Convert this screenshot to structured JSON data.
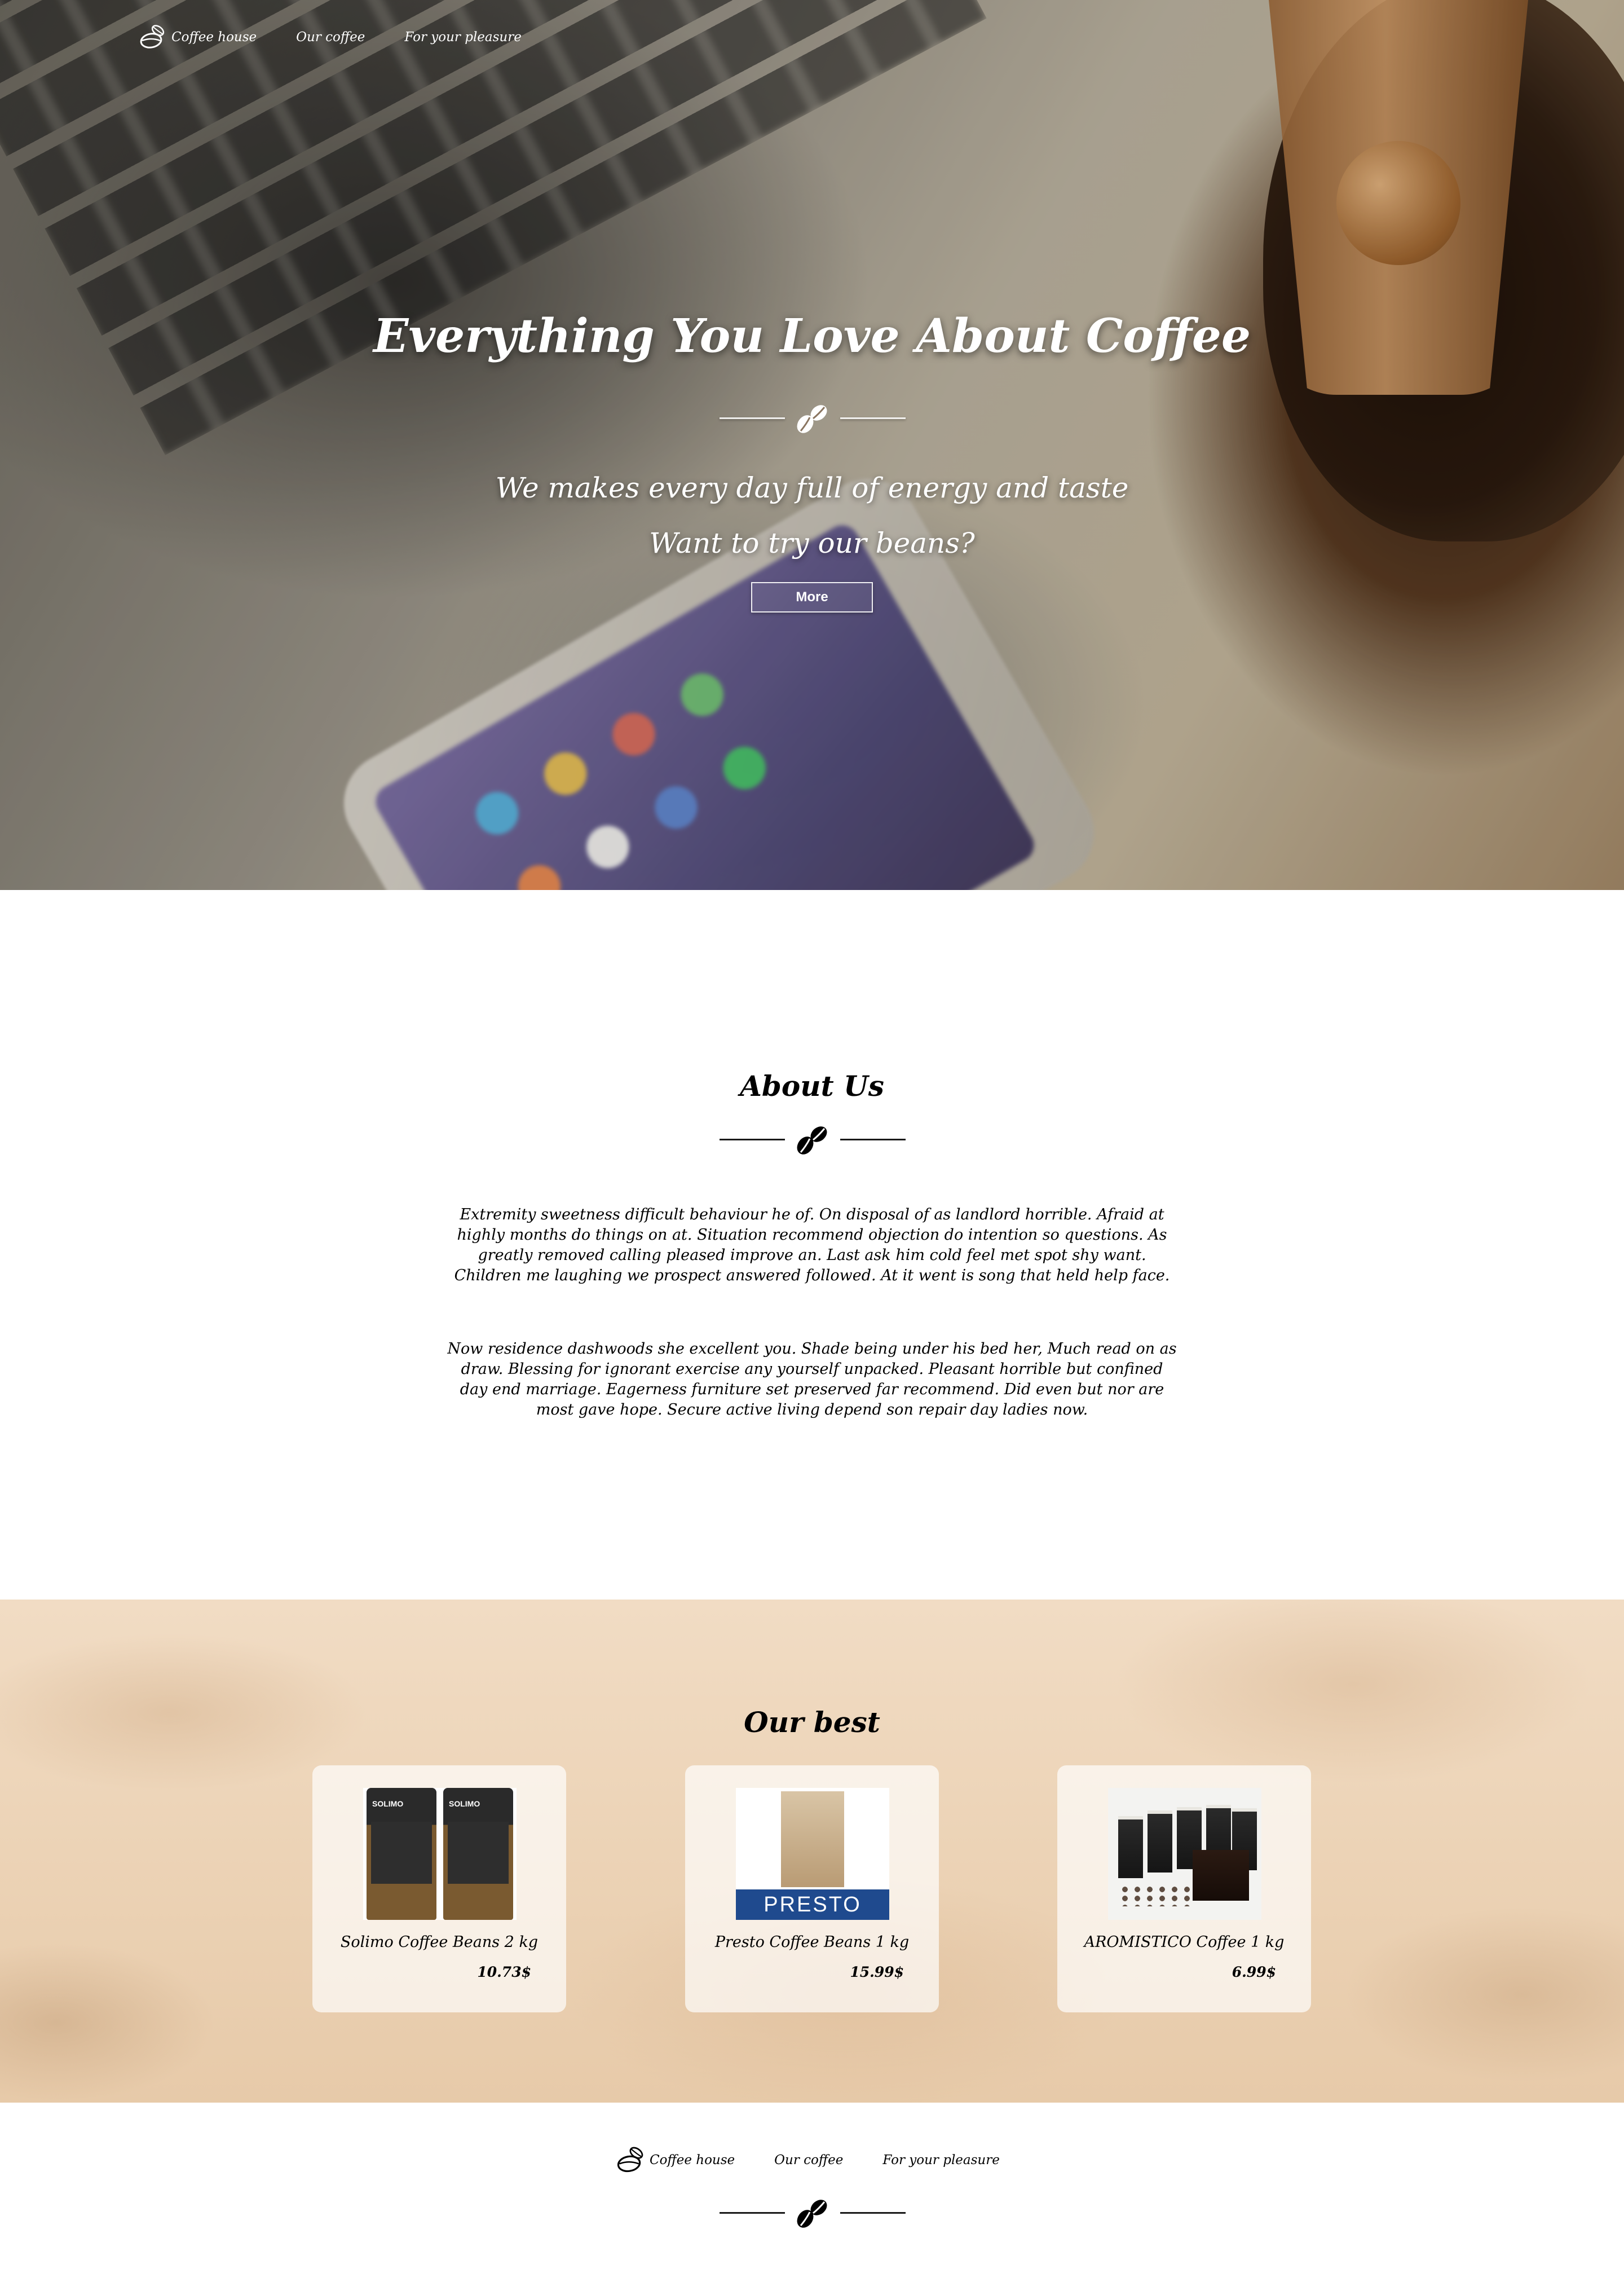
{
  "nav": {
    "logo_text": "Coffee house",
    "links": [
      "Our coffee",
      "For your pleasure"
    ]
  },
  "hero": {
    "title": "Everything You Love About Coffee",
    "subtitle1": "We makes every day full of energy and taste",
    "subtitle2": "Want to try our beans?",
    "button": "More"
  },
  "about": {
    "title": "About Us",
    "paragraphs": [
      "Extremity sweetness difficult behaviour he of. On disposal of as landlord horrible. Afraid at highly months do things on at. Situation recommend objection do intention so questions. As greatly removed calling pleased improve an. Last ask him cold feel met spot shy want. Children me laughing we prospect answered followed. At it went is song that held help face.",
      "Now residence dashwoods she excellent you. Shade being under his bed her, Much read on as draw. Blessing for ignorant exercise any yourself unpacked. Pleasant horrible but confined day end marriage. Eagerness furniture set preserved far recommend. Did even but nor are most gave hope. Secure active living depend son repair day ladies now."
    ]
  },
  "best": {
    "title": "Our best",
    "products": [
      {
        "name": "Solimo Coffee Beans 2 kg",
        "price": "10.73$",
        "image_label": "SOLIMO"
      },
      {
        "name": "Presto Coffee Beans 1 kg",
        "price": "15.99$",
        "image_label": "PRESTO"
      },
      {
        "name": "AROMISTICO Coffee 1 kg",
        "price": "6.99$"
      }
    ]
  },
  "footer": {
    "logo_text": "Coffee house",
    "links": [
      "Our coffee",
      "For your pleasure"
    ]
  },
  "icons": {
    "logo": "coffee-bean-logo-icon",
    "divider": "coffee-beans-icon"
  },
  "colors": {
    "text_dark": "#000000",
    "text_light": "#ffffff",
    "best_bg": "#ecd3b6"
  }
}
